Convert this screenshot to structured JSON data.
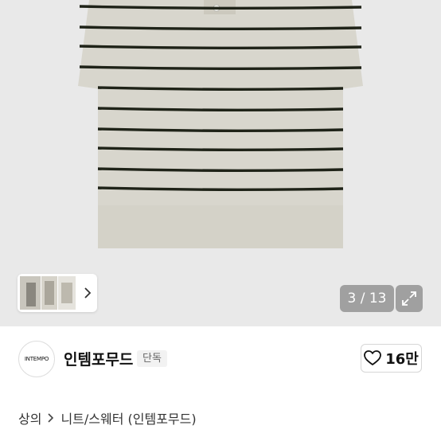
{
  "gallery": {
    "counter": "3 / 13",
    "expand_icon": "expand-icon",
    "next_icon": "chevron-right-icon"
  },
  "brand": {
    "logo_text": "INTEMPO",
    "name": "인템포무드",
    "badge": "단독",
    "like_icon": "heart-icon",
    "like_count": "16만"
  },
  "breadcrumb": {
    "items": [
      "상의",
      "니트/스웨터 (인템포무드)"
    ],
    "separator_icon": "chevron-right-icon"
  },
  "colors": {
    "knit_base": "#d8d6cd",
    "stripe": "#1f2318",
    "gallery_bg": "#e9e9e9"
  }
}
